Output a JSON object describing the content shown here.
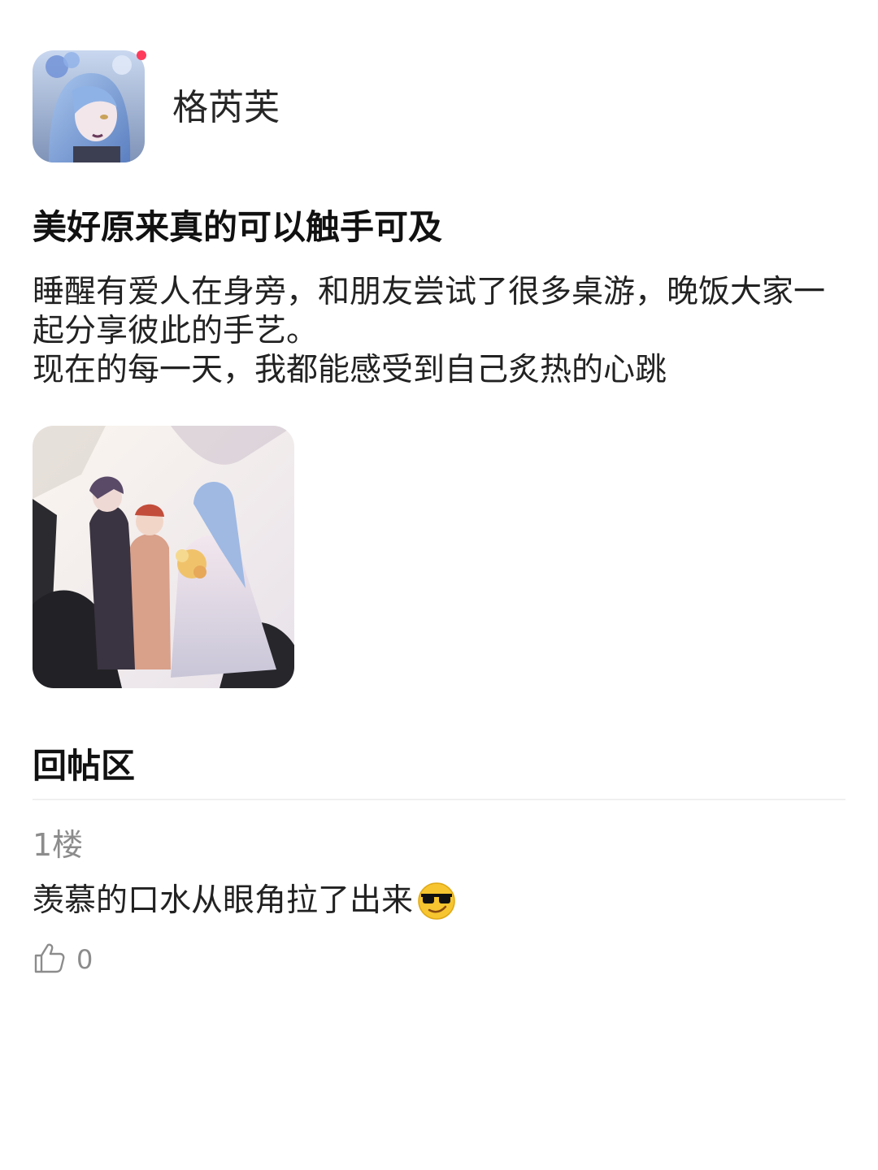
{
  "author": {
    "name": "格芮芙"
  },
  "post": {
    "title": "美好原来真的可以触手可及",
    "body_lines": [
      "睡醒有爱人在身旁，和朋友尝试了很多桌游，晚饭大家一起分享彼此的手艺。",
      "现在的每一天，我都能感受到自己炙热的心跳"
    ]
  },
  "replies": {
    "heading": "回帖区",
    "items": [
      {
        "floor": "1楼",
        "text": "羡慕的口水从眼角拉了出来",
        "emoji": "sunglasses-face-icon",
        "likes": "0"
      }
    ]
  },
  "colors": {
    "accent_dot": "#ff3b5c",
    "muted_text": "#8c8c8c",
    "divider": "#f0f0f0"
  }
}
